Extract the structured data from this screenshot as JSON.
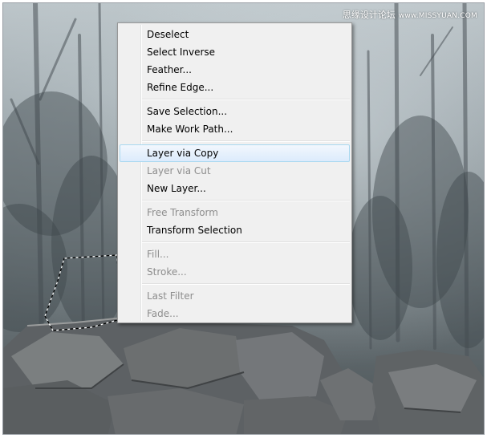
{
  "watermark": {
    "cn": "思缘设计论坛",
    "site": "www.MISSYUAN.COM"
  },
  "context_menu": {
    "groups": [
      [
        {
          "label": "Deselect",
          "enabled": true
        },
        {
          "label": "Select Inverse",
          "enabled": true
        },
        {
          "label": "Feather...",
          "enabled": true
        },
        {
          "label": "Refine Edge...",
          "enabled": true
        }
      ],
      [
        {
          "label": "Save Selection...",
          "enabled": true
        },
        {
          "label": "Make Work Path...",
          "enabled": true
        }
      ],
      [
        {
          "label": "Layer via Copy",
          "enabled": true,
          "highlighted": true
        },
        {
          "label": "Layer via Cut",
          "enabled": false
        },
        {
          "label": "New Layer...",
          "enabled": true
        }
      ],
      [
        {
          "label": "Free Transform",
          "enabled": false
        },
        {
          "label": "Transform Selection",
          "enabled": true
        }
      ],
      [
        {
          "label": "Fill...",
          "enabled": false
        },
        {
          "label": "Stroke...",
          "enabled": false
        }
      ],
      [
        {
          "label": "Last Filter",
          "enabled": false
        },
        {
          "label": "Fade...",
          "enabled": false
        }
      ]
    ]
  },
  "colors": {
    "menu_bg": "#f0f0f0",
    "hover": "#dcebfc",
    "disabled_text": "#8d8d8d"
  }
}
